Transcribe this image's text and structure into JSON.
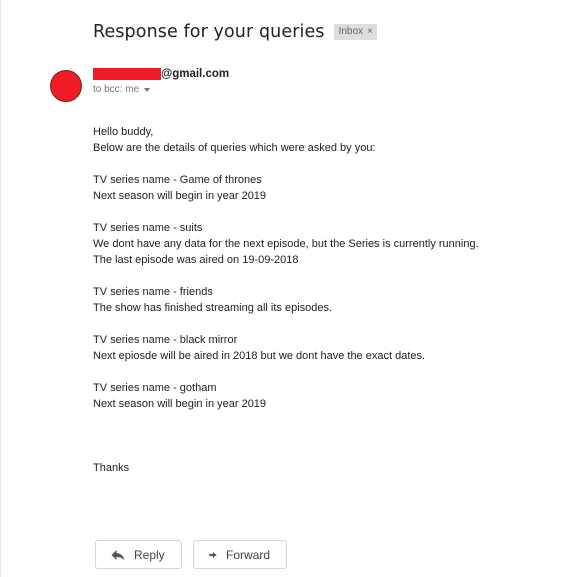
{
  "email": {
    "subject": "Response for your queries",
    "label": "Inbox",
    "label_remove": "×",
    "sender_visible": "@gmail.com",
    "recipient": "to bcc: me",
    "avatar_color": "#ee1c25"
  },
  "body": {
    "greeting": "Hello buddy,",
    "intro": "Below are the details of queries which were asked by you:",
    "blocks": [
      {
        "title": "TV series name - Game of thrones",
        "lines": [
          "Next season will begin in year 2019"
        ]
      },
      {
        "title": "TV series name - suits",
        "lines": [
          "We dont have any data for the next episode, but the Series is currently running.",
          "The last episode was aired on 19-09-2018"
        ]
      },
      {
        "title": "TV series name - friends",
        "lines": [
          "The show has finished streaming all its episodes."
        ]
      },
      {
        "title": "TV series name - black mirror",
        "lines": [
          "Next epiosde will be aired in 2018 but we dont have the exact dates."
        ]
      },
      {
        "title": "TV series name - gotham",
        "lines": [
          "Next season will begin in year 2019"
        ]
      }
    ],
    "signoff": "Thanks"
  },
  "actions": {
    "reply_label": "Reply",
    "forward_label": "Forward",
    "reply_icon": "reply-arrow-icon",
    "forward_icon": "forward-arrow-icon"
  }
}
